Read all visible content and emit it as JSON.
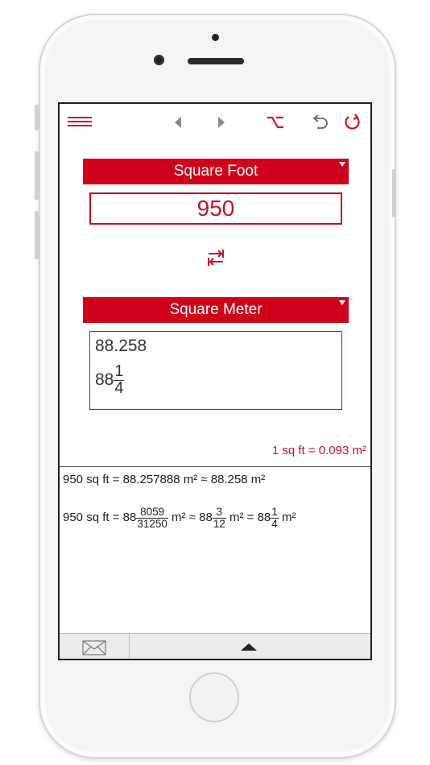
{
  "toolbar": {
    "icons": [
      "menu-icon",
      "back-arrow-icon",
      "forward-arrow-icon",
      "option-key-icon",
      "undo-icon",
      "reset-icon"
    ],
    "accent_color": "#c8102e"
  },
  "from_unit": {
    "label": "Square Foot",
    "value": "950"
  },
  "to_unit": {
    "label": "Square Meter",
    "result_decimal": "88.258",
    "result_whole": "88",
    "result_numerator": "1",
    "result_denominator": "4"
  },
  "conversion_factor": "1 sq ft = 0.093 m²",
  "formula_1": "950 sq ft = 88.257888 m² ≈ 88.258 m²",
  "formula_2": {
    "lhs": "950 sq ft = 88",
    "frac1_num": "8059",
    "frac1_den": "31250",
    "mid1": " m² ≈ 88",
    "frac2_num": "3",
    "frac2_den": "12",
    "mid2": " m² = 88",
    "frac3_num": "1",
    "frac3_den": "4",
    "tail": " m²"
  },
  "bottom_bar": {
    "icons": [
      "mail-icon",
      "expand-up-icon"
    ]
  }
}
